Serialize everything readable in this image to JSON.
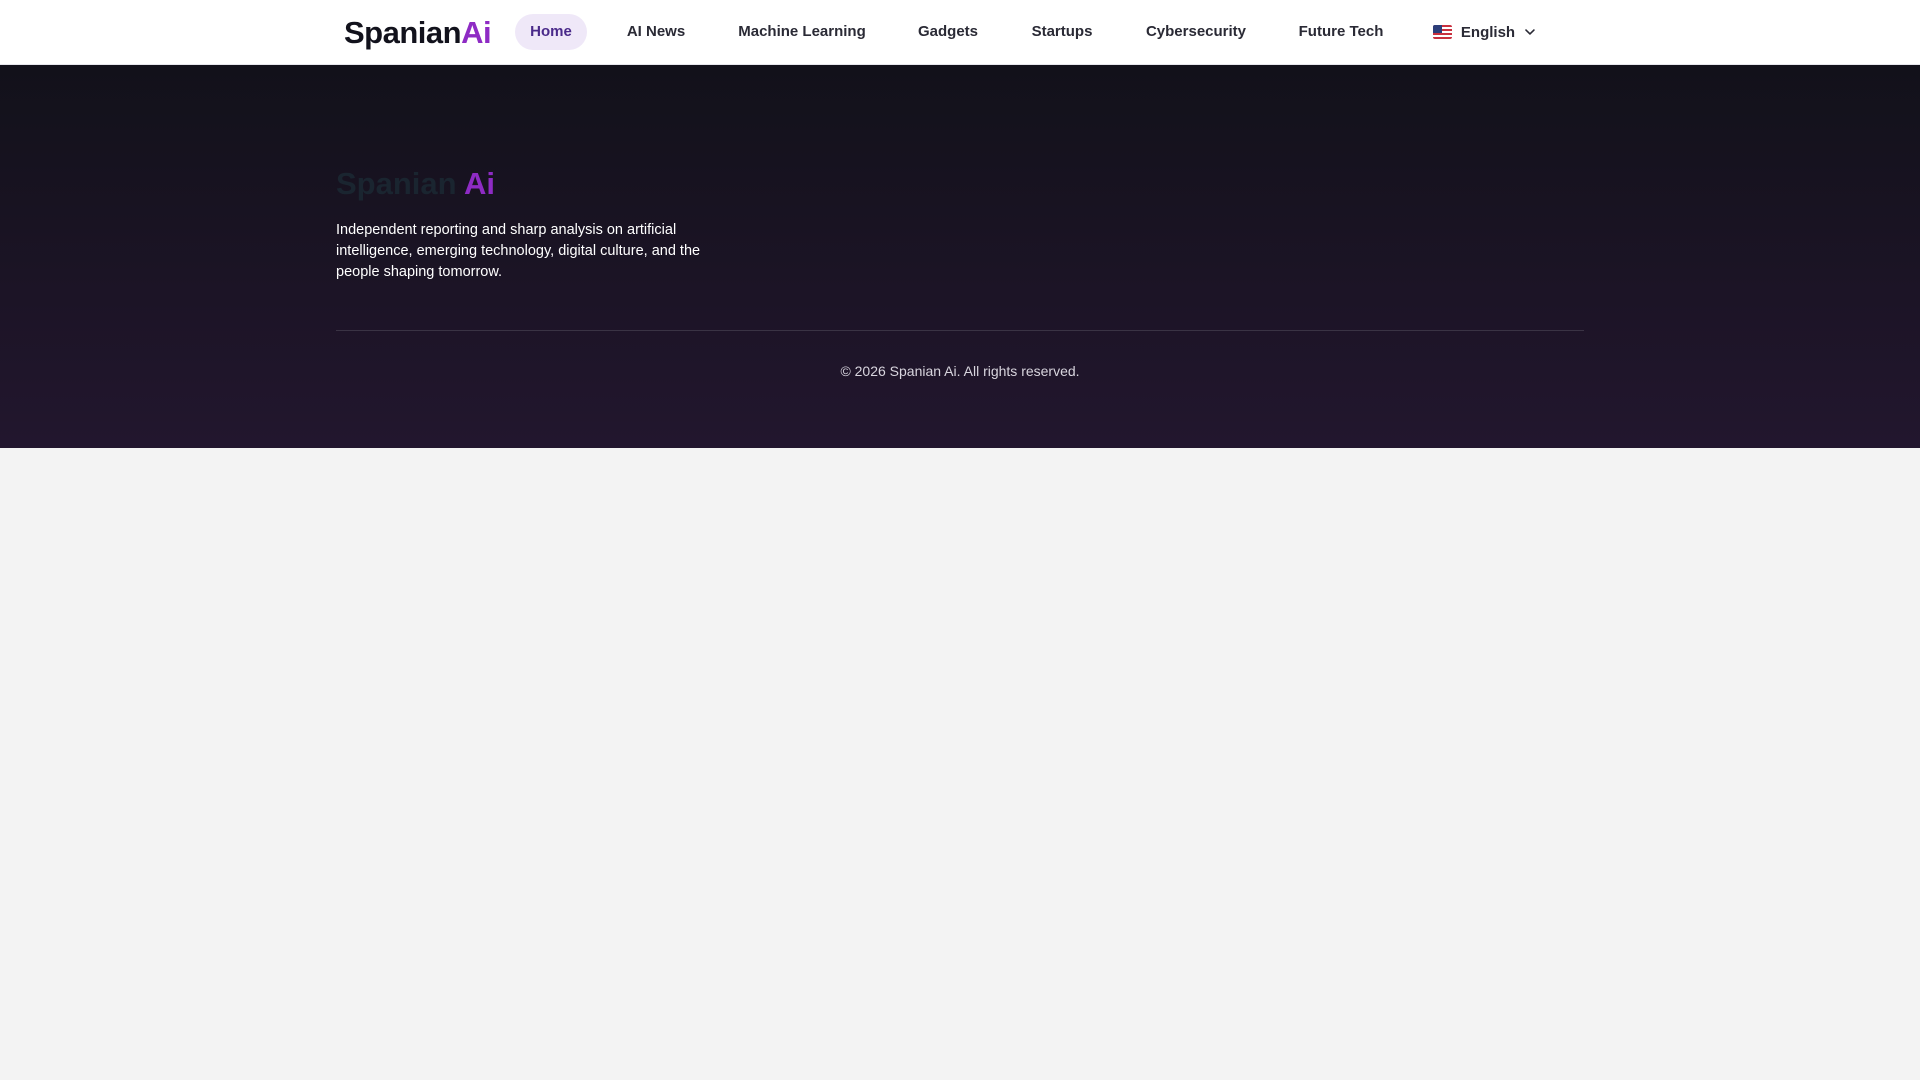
{
  "header": {
    "logo": {
      "main": "Spanian",
      "accent": "Ai"
    },
    "nav": [
      {
        "label": "Home",
        "active": true
      },
      {
        "label": "AI News",
        "active": false
      },
      {
        "label": "Machine Learning",
        "active": false
      },
      {
        "label": "Gadgets",
        "active": false
      },
      {
        "label": "Startups",
        "active": false
      },
      {
        "label": "Cybersecurity",
        "active": false
      },
      {
        "label": "Future Tech",
        "active": false
      }
    ],
    "language": {
      "label": "English",
      "flag_icon": "us-flag-icon"
    }
  },
  "footer": {
    "logo": {
      "main": "Spanian ",
      "accent": "Ai"
    },
    "description": "Independent reporting and sharp analysis on artificial intelligence, emerging technology, digital culture, and the people shaping tomorrow.",
    "copyright": "© 2026 Spanian Ai. All rights reserved."
  },
  "colors": {
    "accent": "#8e2bc4",
    "active_nav_bg": "#efe8f8",
    "footer_bg_top": "#12111a",
    "footer_bg_bottom": "#22162e",
    "page_bg": "#f3f3f3"
  }
}
